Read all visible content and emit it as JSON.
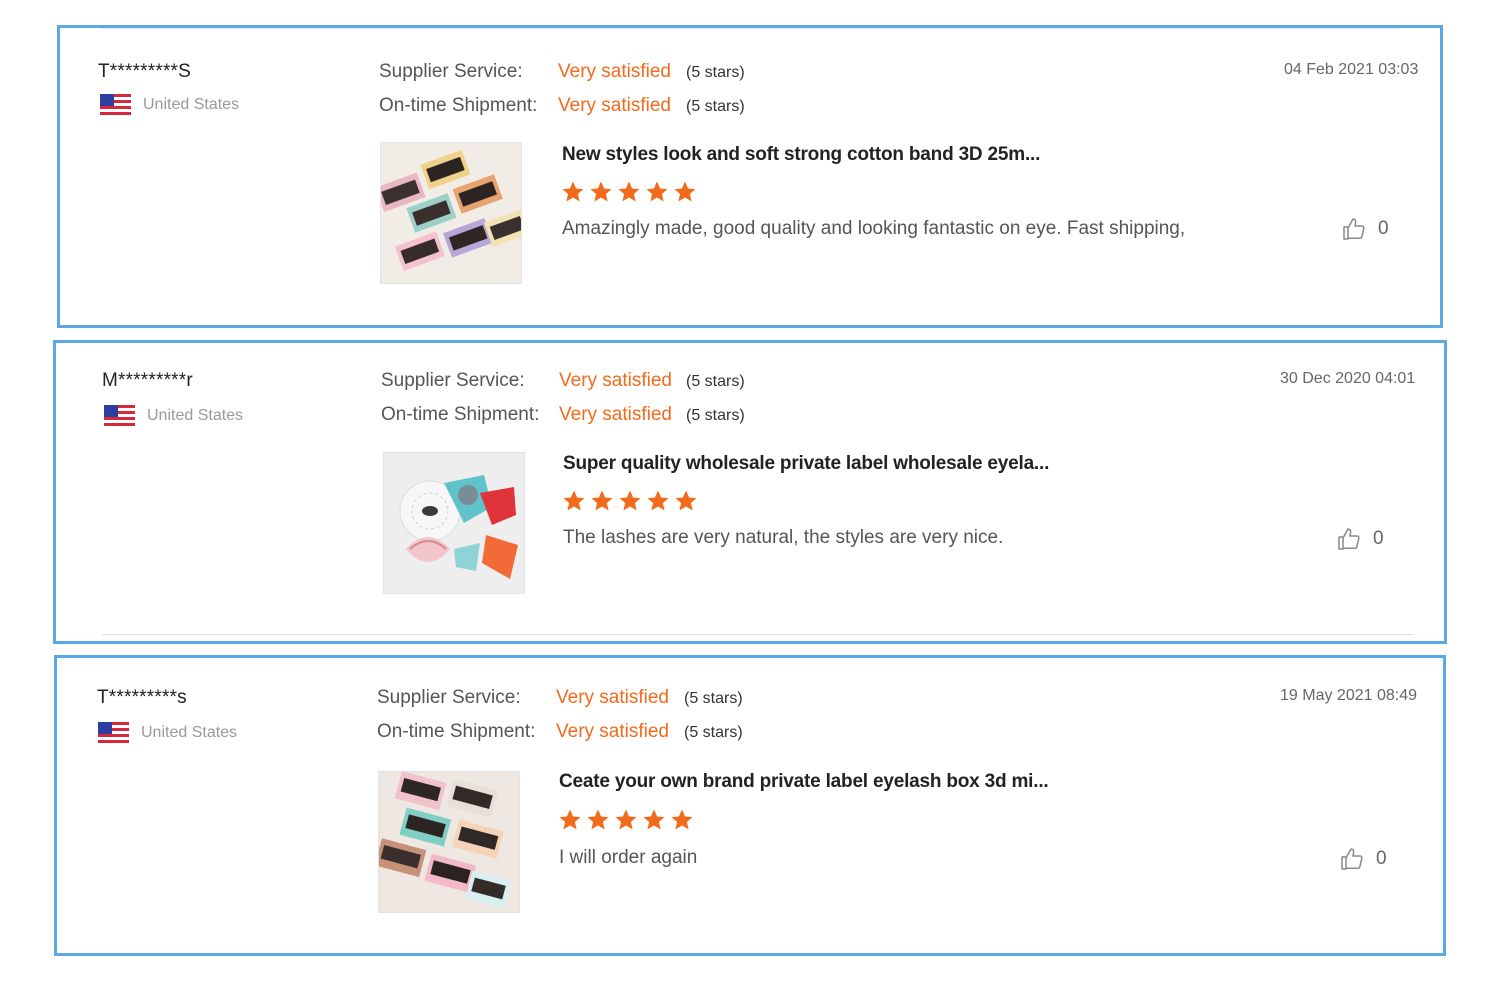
{
  "labels": {
    "supplier_service": "Supplier Service:",
    "ontime_shipment": "On-time Shipment:"
  },
  "colors": {
    "border": "#5aa8e6",
    "rating": "#f26a1b",
    "star": "#f26a1b"
  },
  "reviews": [
    {
      "user": "T*********S",
      "country": "United States",
      "supplier_rating": "Very satisfied",
      "supplier_stars": "(5 stars)",
      "shipment_rating": "Very satisfied",
      "shipment_stars": "(5 stars)",
      "date": "04 Feb 2021 03:03",
      "product_title": "New styles look and soft strong cotton band 3D 25m...",
      "star_rating": 5,
      "comment": "Amazingly made, good quality and looking fantastic on eye. Fast shipping,",
      "likes": "0",
      "icons": [
        "us-flag-icon",
        "star-icon",
        "thumbs-up-icon"
      ]
    },
    {
      "user": "M*********r",
      "country": "United States",
      "supplier_rating": "Very satisfied",
      "supplier_stars": "(5 stars)",
      "shipment_rating": "Very satisfied",
      "shipment_stars": "(5 stars)",
      "date": "30 Dec 2020 04:01",
      "product_title": "Super quality wholesale private label wholesale eyela...",
      "star_rating": 5,
      "comment": "The lashes are very natural, the styles are very nice.",
      "likes": "0",
      "icons": [
        "us-flag-icon",
        "star-icon",
        "thumbs-up-icon"
      ]
    },
    {
      "user": "T*********s",
      "country": "United States",
      "supplier_rating": "Very satisfied",
      "supplier_stars": "(5 stars)",
      "shipment_rating": "Very satisfied",
      "shipment_stars": "(5 stars)",
      "date": "19 May 2021 08:49",
      "product_title": "Ceate your own brand private label eyelash box 3d mi...",
      "star_rating": 5,
      "comment": "I will order again",
      "likes": "0",
      "icons": [
        "us-flag-icon",
        "star-icon",
        "thumbs-up-icon"
      ]
    }
  ]
}
